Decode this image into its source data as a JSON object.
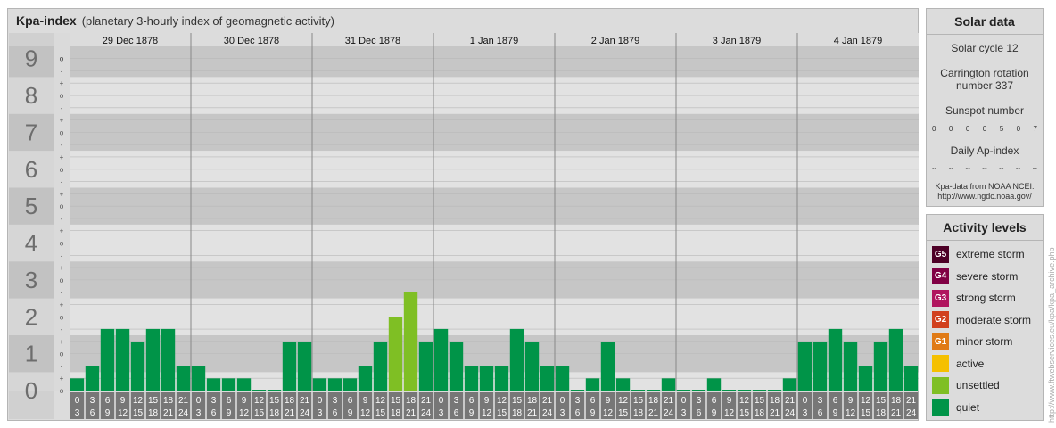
{
  "header": {
    "title": "Kpa-index",
    "subtitle": "(planetary 3-hourly index of geomagnetic activity)"
  },
  "solar_panel": {
    "title": "Solar data",
    "solar_cycle": "Solar cycle 12",
    "carrington_line1": "Carrington rotation",
    "carrington_line2": "number 337",
    "sunspot_label": "Sunspot number",
    "sunspot_values": [
      "0",
      "0",
      "0",
      "0",
      "5",
      "0",
      "7"
    ],
    "ap_label": "Daily Ap-index",
    "ap_values": [
      "--",
      "--",
      "--",
      "--",
      "--",
      "--",
      "--"
    ],
    "source_line1": "Kpa-data from NOAA NCEI:",
    "source_line2": "http://www.ngdc.noaa.gov/"
  },
  "activity_panel": {
    "title": "Activity levels",
    "levels": [
      {
        "badge": "G5",
        "label": "extreme storm",
        "color": "#4d0026"
      },
      {
        "badge": "G4",
        "label": "severe storm",
        "color": "#800044"
      },
      {
        "badge": "G3",
        "label": "strong storm",
        "color": "#b0155e"
      },
      {
        "badge": "G2",
        "label": "moderate storm",
        "color": "#d1401e"
      },
      {
        "badge": "G1",
        "label": "minor storm",
        "color": "#e07a15"
      },
      {
        "badge": "",
        "label": "active",
        "color": "#f5c000"
      },
      {
        "badge": "",
        "label": "unsettled",
        "color": "#7fbf24"
      },
      {
        "badge": "",
        "label": "quiet",
        "color": "#009448"
      }
    ]
  },
  "credit": "http://www.ftwebservices.eu/kpa/kpa_archive.php",
  "chart_data": {
    "type": "bar",
    "y_ticks": [
      "0",
      "1",
      "2",
      "3",
      "4",
      "5",
      "6",
      "7",
      "8",
      "9"
    ],
    "sub_ticks": [
      "+",
      "o",
      "-"
    ],
    "ylim": [
      0,
      9.33
    ],
    "days": [
      "29 Dec 1878",
      "30 Dec 1878",
      "31 Dec 1878",
      "1 Jan 1879",
      "2 Jan 1879",
      "3 Jan 1879",
      "4 Jan 1879"
    ],
    "interval_start": [
      "0",
      "3",
      "6",
      "9",
      "12",
      "15",
      "18",
      "21"
    ],
    "interval_end": [
      "3",
      "6",
      "9",
      "12",
      "15",
      "18",
      "21",
      "24"
    ],
    "series": [
      {
        "values": [
          0.33,
          0.67,
          1.67,
          1.67,
          1.33,
          1.67,
          1.67,
          0.67
        ]
      },
      {
        "values": [
          0.67,
          0.33,
          0.33,
          0.33,
          0,
          0,
          1.33,
          1.33
        ]
      },
      {
        "values": [
          0.33,
          0.33,
          0.33,
          0.67,
          1.33,
          2,
          2.67,
          1.33
        ]
      },
      {
        "values": [
          1.67,
          1.33,
          0.67,
          0.67,
          0.67,
          1.67,
          1.33,
          0.67
        ]
      },
      {
        "values": [
          0.67,
          0,
          0.33,
          1.33,
          0.33,
          0,
          0,
          0.33
        ]
      },
      {
        "values": [
          0,
          0,
          0.33,
          0,
          0,
          0,
          0,
          0.33
        ]
      },
      {
        "values": [
          1.33,
          1.33,
          1.67,
          1.33,
          0.67,
          1.33,
          1.67,
          0.67
        ]
      }
    ],
    "colors": {
      "quiet": "#009448",
      "unsettled": "#7fbf24",
      "active": "#f5c000"
    },
    "grid": true
  }
}
